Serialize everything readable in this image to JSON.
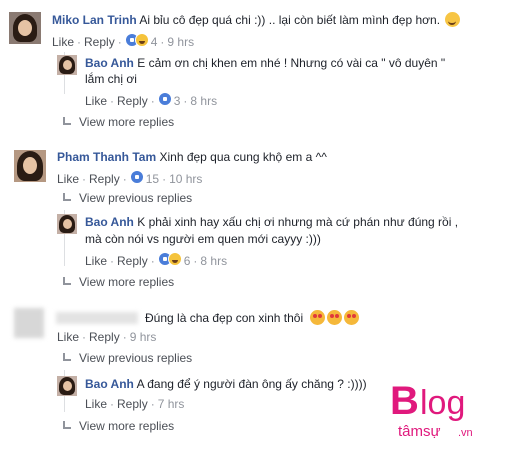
{
  "comments": [
    {
      "name": "Miko Lan Trinh",
      "text": "Ai bỉu cô đẹp quá chi :)) .. lại còn biết làm mình đẹp hơn.",
      "like": "Like",
      "reply": "Reply",
      "reaction_count": "4",
      "time": "9 hrs"
    },
    {
      "name": "Bao Anh",
      "text_line1": "E cảm ơn chị khen em nhé ! Nhưng có vài ca \" vô duyên \"",
      "text_line2": "lắm chị ơi",
      "like": "Like",
      "reply": "Reply",
      "reaction_count": "3",
      "time": "8 hrs"
    },
    {
      "view_more": "View more replies"
    },
    {
      "name": "Pham Thanh Tam",
      "text": "Xinh đẹp qua cung khộ em a ^^",
      "like": "Like",
      "reply": "Reply",
      "reaction_count": "15",
      "time": "10 hrs",
      "view_previous": "View previous replies"
    },
    {
      "name": "Bao Anh",
      "text_line1": "K phải xinh hay xấu chị ơi nhưng mà cứ phán như đúng rồi ,",
      "text_line2": "mà còn nói vs người em quen mới cayyy :)))",
      "like": "Like",
      "reply": "Reply",
      "reaction_count": "6",
      "time": "8 hrs",
      "view_more": "View more replies"
    },
    {
      "text": "Đúng là cha đẹp con xinh thôi",
      "like": "Like",
      "reply": "Reply",
      "time": "9 hrs",
      "view_previous": "View previous replies"
    },
    {
      "name": "Bao Anh",
      "text": "A đang để ý người đàn ông ấy chăng ? :))))",
      "like": "Like",
      "reply": "Reply",
      "time": "7 hrs",
      "view_more": "View more replies"
    }
  ],
  "watermark": {
    "logo_text": "Blog",
    "sub_text": "tâmsự",
    "suffix": ".vn",
    "color": "#e0197d"
  },
  "colors": {
    "name": "#365899",
    "meta": "#90949c",
    "link": "#4b4f56"
  },
  "icons": [
    "like-reaction-icon",
    "haha-reaction-icon",
    "reply-arrow-icon",
    "heart-eyes-emoji",
    "wink-emoji"
  ]
}
